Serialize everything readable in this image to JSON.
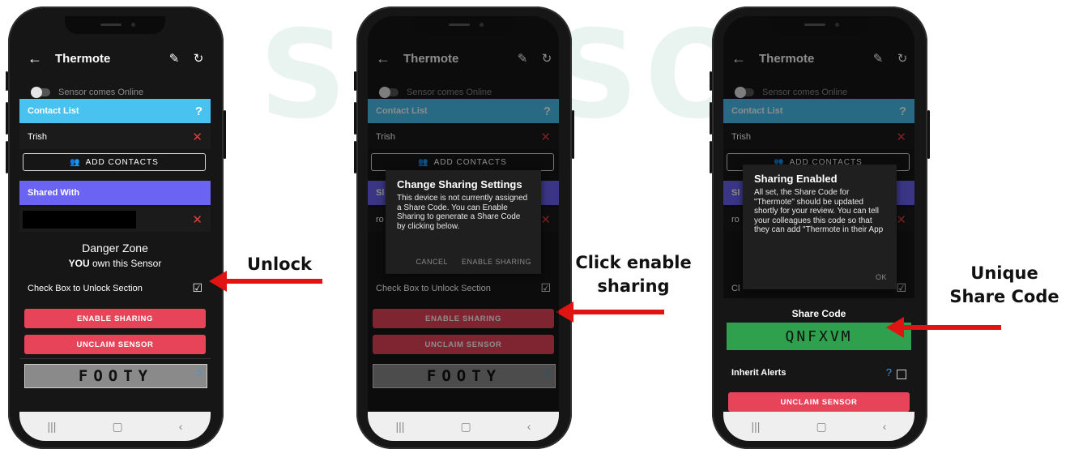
{
  "watermark": "SENSOR",
  "phones": [
    {
      "app_title": "Thermote",
      "toggle_label": "Sensor comes Online",
      "contact_list_header": "Contact List",
      "contact_name": "Trish",
      "add_contacts_label": "ADD CONTACTS",
      "shared_with_header": "Shared With",
      "danger_title": "Danger Zone",
      "owner_strong": "YOU",
      "owner_rest": " own this Sensor",
      "unlock_label": "Check Box to Unlock Section",
      "enable_sharing": "ENABLE SHARING",
      "unclaim": "UNCLAIM SENSOR",
      "share_code": "FOOTY",
      "help_glyph": "?"
    },
    {
      "app_title": "Thermote",
      "toggle_label": "Sensor comes Online",
      "contact_list_header": "Contact List",
      "contact_name": "Trish",
      "add_contacts_label": "ADD CONTACTS",
      "shared_with_partial": "Sl",
      "shared_contact_partial": "ro",
      "unlock_label": "Check Box to Unlock Section",
      "enable_sharing": "ENABLE SHARING",
      "unclaim": "UNCLAIM SENSOR",
      "share_code": "FOOTY",
      "help_glyph": "?",
      "dialog": {
        "title": "Change Sharing Settings",
        "body": "This device is not currently assigned a Share Code. You can Enable Sharing to generate a Share Code by clicking below.",
        "cancel": "CANCEL",
        "confirm": "ENABLE SHARING"
      }
    },
    {
      "app_title": "Thermote",
      "toggle_label": "Sensor comes Online",
      "contact_list_header": "Contact List",
      "contact_name": "Trish",
      "add_contacts_partial": "ADD CONTACTS",
      "shared_with_partial": "Sl",
      "shared_contact_partial": "ro",
      "check_partial": "Cl",
      "share_code_header": "Share Code",
      "share_code": "QNFXVM",
      "inherit_alerts": "Inherit Alerts",
      "unclaim": "UNCLAIM SENSOR",
      "help_glyph": "?",
      "dialog": {
        "title": "Sharing Enabled",
        "body": "All set, the Share Code for \"Thermote\" should be updated shortly for your review. You can tell your colleagues this code so that they can add \"Thermote in their App",
        "ok": "OK"
      }
    }
  ],
  "annotations": {
    "unlock": "Unlock",
    "click_enable_line1": "Click enable",
    "click_enable_line2": "sharing",
    "unique_line1": "Unique",
    "unique_line2": "Share Code"
  },
  "colors": {
    "contact_header": "#4ac2f0",
    "contact_header_dim": "#3b8bb0",
    "shared_header": "#6b63f2",
    "danger_button": "#e84459",
    "share_code_bg": "#2ea04e",
    "arrow": "#e11414"
  },
  "icons": [
    "back-arrow-icon",
    "pencil-icon",
    "refresh-icon",
    "help-icon",
    "remove-icon",
    "add-contacts-icon",
    "checkbox-icon",
    "nav-recents-icon",
    "nav-home-icon",
    "nav-back-icon"
  ]
}
